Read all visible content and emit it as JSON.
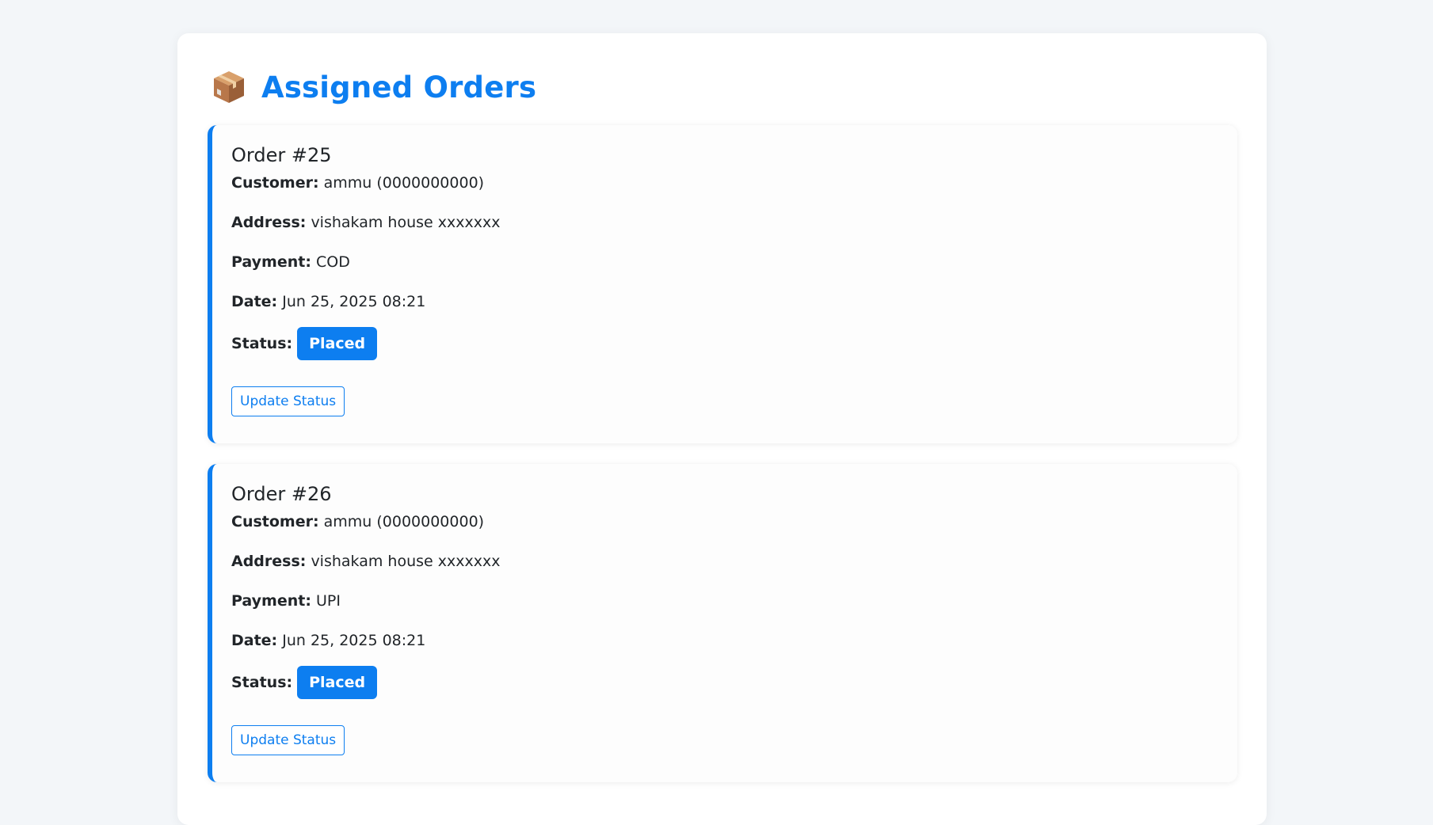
{
  "header": {
    "icon": "package-box-icon",
    "title": "Assigned Orders"
  },
  "colors": {
    "accent": "#0d7ef0",
    "background": "#f3f6f9"
  },
  "orders": [
    {
      "title": "Order #25",
      "customer_label": "Customer:",
      "customer": "ammu (0000000000)",
      "address_label": "Address:",
      "address": "vishakam house xxxxxxx",
      "payment_label": "Payment:",
      "payment": "COD",
      "date_label": "Date:",
      "date": "Jun 25, 2025 08:21",
      "status_label": "Status:",
      "status": "Placed",
      "button_label": "Update Status"
    },
    {
      "title": "Order #26",
      "customer_label": "Customer:",
      "customer": "ammu (0000000000)",
      "address_label": "Address:",
      "address": "vishakam house xxxxxxx",
      "payment_label": "Payment:",
      "payment": "UPI",
      "date_label": "Date:",
      "date": "Jun 25, 2025 08:21",
      "status_label": "Status:",
      "status": "Placed",
      "button_label": "Update Status"
    }
  ]
}
